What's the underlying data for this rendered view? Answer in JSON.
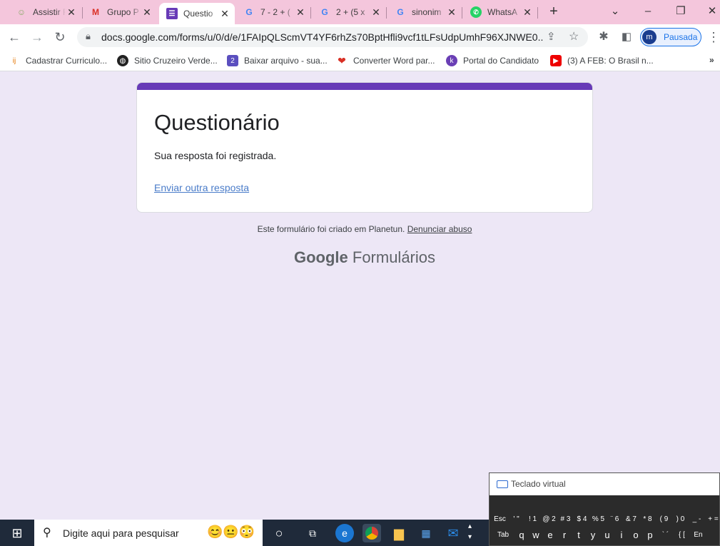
{
  "tabs": [
    {
      "title": "Assistir F",
      "favicon": "anime-favicon",
      "active": false
    },
    {
      "title": "Grupo P",
      "favicon": "gmail-icon",
      "active": false
    },
    {
      "title": "Questio",
      "favicon": "google-forms-icon",
      "active": true
    },
    {
      "title": "7 - 2 + (",
      "favicon": "google-icon",
      "active": false
    },
    {
      "title": "2 + (5 x",
      "favicon": "google-icon",
      "active": false
    },
    {
      "title": "sinonim",
      "favicon": "google-icon",
      "active": false
    },
    {
      "title": "WhatsA",
      "favicon": "whatsapp-icon",
      "active": false
    }
  ],
  "address": {
    "url": "docs.google.com/forms/u/0/d/e/1FAIpQLScmVT4YF6rhZs70BptHfli9vcf1tLFsUdpUmhF96XJNWE0..."
  },
  "profile": {
    "initial": "m",
    "label": "Pausada"
  },
  "bookmarks": [
    {
      "label": "Cadastrar Curriculo..."
    },
    {
      "label": "Sitio Cruzeiro Verde..."
    },
    {
      "label": "Baixar arquivo - sua..."
    },
    {
      "label": "Converter Word par..."
    },
    {
      "label": "Portal do Candidato"
    },
    {
      "label": "(3) A FEB: O Brasil n..."
    }
  ],
  "form": {
    "title": "Questionário",
    "message": "Sua resposta foi registrada.",
    "link": "Enviar outra resposta",
    "footer_text": "Este formulário foi criado em Planetun.",
    "footer_link": "Denunciar abuso",
    "brand_google": "Google",
    "brand_product": "Formulários"
  },
  "keyboard": {
    "title": "Teclado virtual",
    "row1": [
      "Esc",
      "' \"",
      "! 1",
      "@ 2",
      "# 3",
      "$ 4",
      "% 5",
      "¨ 6",
      "& 7",
      "* 8",
      "( 9",
      ") 0",
      "_ -",
      "+ ="
    ],
    "row2": [
      "Tab",
      "q",
      "w",
      "e",
      "r",
      "t",
      "y",
      "u",
      "i",
      "o",
      "p",
      "` ´",
      "{ [",
      "En"
    ]
  },
  "taskbar": {
    "search_placeholder": "Digite aqui para pesquisar"
  },
  "colors": {
    "form_accent": "#673ab7",
    "tabstrip": "#f4c6dc",
    "page_bg": "#ede7f6"
  }
}
